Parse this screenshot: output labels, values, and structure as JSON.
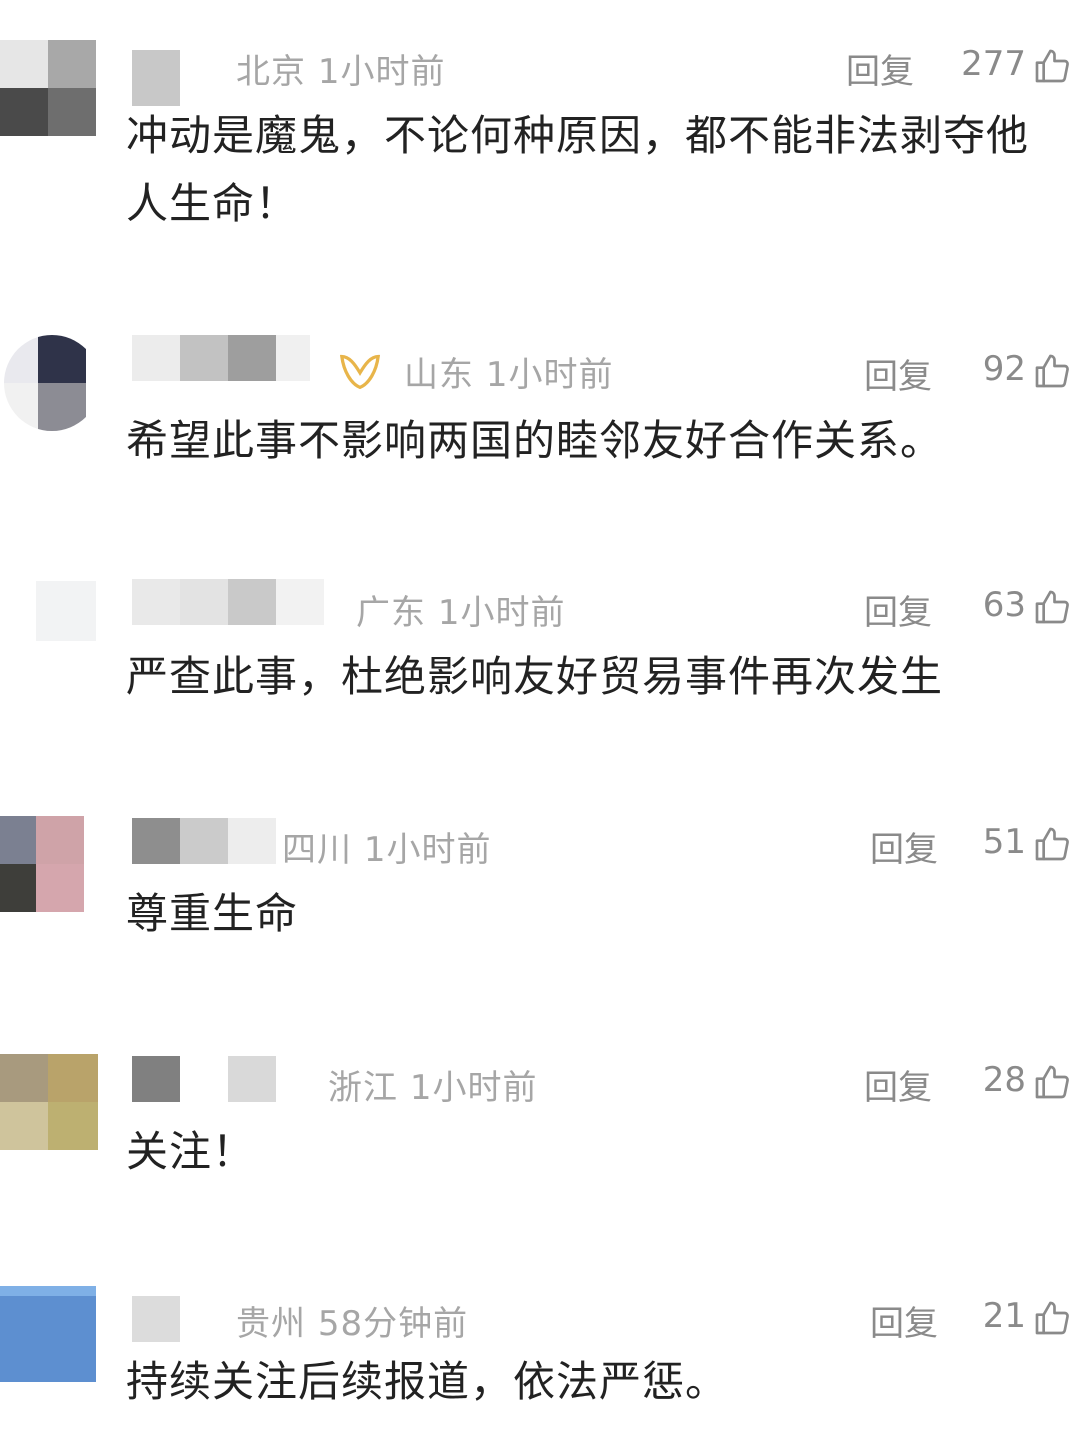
{
  "comments": [
    {
      "location": "北京",
      "time": "1小时前",
      "reply_label": "回复",
      "likes": "277",
      "text": "冲动是魔鬼，不论何种原因，都不能非法剥夺他人生命！"
    },
    {
      "location": "山东",
      "time": "1小时前",
      "reply_label": "回复",
      "likes": "92",
      "text": "希望此事不影响两国的睦邻友好合作关系。"
    },
    {
      "location": "广东",
      "time": "1小时前",
      "reply_label": "回复",
      "likes": "63",
      "text": "严查此事，杜绝影响友好贸易事件再次发生"
    },
    {
      "location": "四川",
      "time": "1小时前",
      "reply_label": "回复",
      "likes": "51",
      "text": "尊重生命"
    },
    {
      "location": "浙江",
      "time": "1小时前",
      "reply_label": "回复",
      "likes": "28",
      "text": "关注！"
    },
    {
      "location": "贵州",
      "time": "58分钟前",
      "reply_label": "回复",
      "likes": "21",
      "text": "持续关注后续报道，依法严惩。"
    }
  ],
  "icons": {
    "like": "thumbs-up-icon",
    "badge": "gold-badge-icon"
  },
  "colors": {
    "meta": "#a6a6a6",
    "text": "#222222",
    "badge": "#e8b54a"
  }
}
